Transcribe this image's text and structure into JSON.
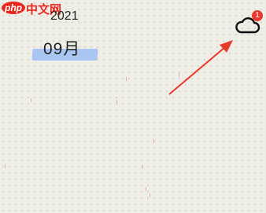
{
  "watermark": {
    "logo_text": "php",
    "site_text": "中文网"
  },
  "calendar": {
    "year": "2021",
    "month": "09月"
  },
  "sync": {
    "icon": "cloud-icon",
    "badge_count": "1"
  },
  "colors": {
    "background": "#eeede6",
    "highlight": "#a9c6f2",
    "badge": "#e8392c",
    "annotation_arrow": "#e8392c"
  }
}
